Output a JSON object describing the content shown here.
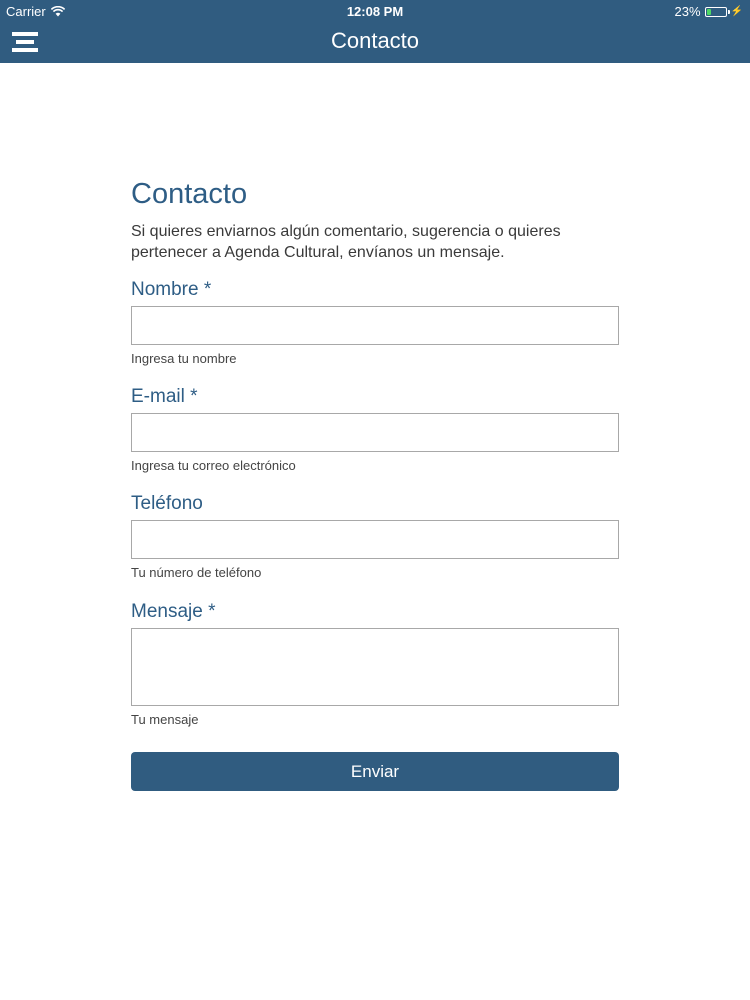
{
  "status_bar": {
    "carrier": "Carrier",
    "time": "12:08 PM",
    "battery_percent": "23%",
    "battery_level": 0.23,
    "icons": [
      "wifi-icon",
      "battery-icon",
      "charging-bolt-icon"
    ]
  },
  "nav": {
    "title": "Contacto",
    "menu_icon": "hamburger-menu-icon"
  },
  "form": {
    "title": "Contacto",
    "intro": "Si quieres enviarnos algún comentario, sugerencia o quieres pertenecer a Agenda Cultural, envíanos un mensaje.",
    "fields": [
      {
        "label": "Nombre *",
        "value": "",
        "hint": "Ingresa tu nombre"
      },
      {
        "label": "E-mail *",
        "value": "",
        "hint": "Ingresa tu correo electrónico"
      },
      {
        "label": "Teléfono",
        "value": "",
        "hint": "Tu número de teléfono"
      },
      {
        "label": "Mensaje *",
        "value": "",
        "hint": "Tu mensaje"
      }
    ],
    "submit_label": "Enviar"
  },
  "colors": {
    "header_background": "#305c80",
    "title_text": "#2e5d85",
    "button_background": "#305c80",
    "battery_fill": "#4cd964"
  }
}
